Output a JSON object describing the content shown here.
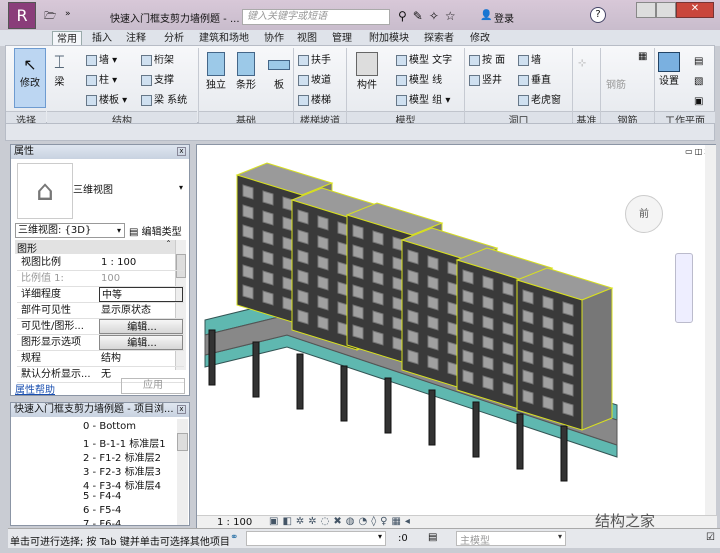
{
  "window": {
    "title": "快速入门框支剪力墙例题 - ...",
    "search_placeholder": "键入关键字或短语",
    "login": "登录",
    "help": "?"
  },
  "tabs": [
    "常用",
    "插入",
    "注释",
    "分析",
    "建筑和场地",
    "协作",
    "视图",
    "管理",
    "附加模块",
    "探索者",
    "修改"
  ],
  "ribbon": {
    "modify": "修改",
    "beam": "梁",
    "wall": "墙",
    "column": "柱",
    "floor": "楼板",
    "truss": "桁架",
    "brace": "支撑",
    "beam_system": "梁 系统",
    "isolated": "独立",
    "strip": "条形",
    "slab": "板",
    "railing": "扶手",
    "ramp": "坡道",
    "stair": "楼梯",
    "component": "构件",
    "model_text": "模型 文字",
    "model_line": "模型 线",
    "model_group": "模型 组",
    "by_face": "按 面",
    "shaft": "竖井",
    "opening_wall": "墙",
    "vertical": "垂直",
    "dormer": "老虎窗",
    "rebar": "钢筋",
    "set": "设置",
    "panels": [
      "选择",
      "结构",
      "基础",
      "楼梯坡道",
      "模型",
      "洞口",
      "基准",
      "钢筋",
      "工作平面"
    ]
  },
  "properties": {
    "title": "属性",
    "type": "三维视图",
    "selector": "三维视图: {3D}",
    "edit_type": "编辑类型",
    "group": "图形",
    "rows": [
      {
        "k": "视图比例",
        "v": "1 : 100"
      },
      {
        "k": "比例值 1:",
        "v": "100"
      },
      {
        "k": "详细程度",
        "v": "中等"
      },
      {
        "k": "部件可见性",
        "v": "显示原状态"
      },
      {
        "k": "可见性/图形...",
        "v": "编辑..."
      },
      {
        "k": "图形显示选项",
        "v": "编辑..."
      },
      {
        "k": "规程",
        "v": "结构"
      },
      {
        "k": "默认分析显示...",
        "v": "无"
      }
    ],
    "help": "属性帮助",
    "apply": "应用"
  },
  "browser": {
    "title": "快速入门框支剪力墙例题 - 项目浏...",
    "items": [
      "0 - Bottom",
      "1 - B-1-1 标准层1",
      "2 - F1-2 标准层2",
      "3 - F2-3 标准层3",
      "4 - F3-4 标准层4",
      "5 - F4-4",
      "6 - F5-4",
      "7 - F6-4"
    ]
  },
  "viewport": {
    "scale": "1 : 100",
    "viewcube": "前",
    "watermark": "结构之家"
  },
  "status": {
    "text": "单击可进行选择; 按 Tab 键并单击可选择其他项目",
    "count": ":0",
    "model": "主模型"
  },
  "colors": {
    "concrete": "#9a9a9a",
    "edge": "#d8e020",
    "beam": "#5fb8b0"
  }
}
